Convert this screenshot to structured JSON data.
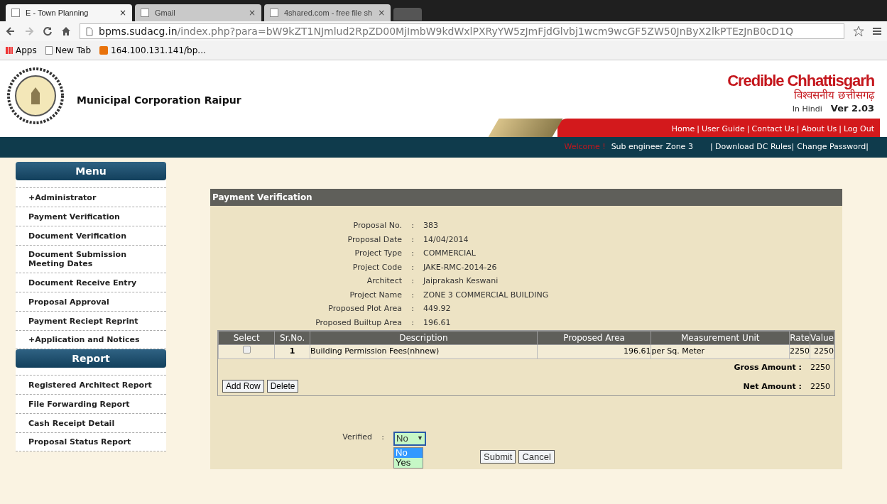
{
  "browser": {
    "tabs": [
      {
        "title": "E - Town Planning",
        "close": "×",
        "selected": true
      },
      {
        "title": "Gmail",
        "close": "×",
        "selected": false
      },
      {
        "title": "4shared.com - free file sh",
        "close": "×",
        "selected": false
      }
    ],
    "url_host": "bpms.sudacg.in",
    "url_path": "/index.php?para=bW9kZT1NJmlud2RpZD00MjImbW9kdWxlPXRyYW5zJmFjdGlvbj1wcm9wcGF5ZW50JnByX2lkPTEzJnB0cD1Q",
    "bookmarks": [
      {
        "label": "Apps",
        "kind": "apps"
      },
      {
        "label": "New Tab",
        "kind": "page"
      },
      {
        "label": "164.100.131.141/bp...",
        "kind": "site"
      }
    ]
  },
  "header": {
    "org_name": "Municipal Corporation Raipur",
    "brand": "Credible Chhattisgarh",
    "brand_hindi": "विश्वसनीय छत्तीसगढ़",
    "language_link": "In Hindi",
    "version": "Ver 2.03",
    "separator": "|",
    "nav_links": [
      "Home",
      "User Guide",
      "Contact Us",
      "About Us",
      "Log Out"
    ]
  },
  "user_bar": {
    "welcome": "Welcome !",
    "user": "Sub engineer Zone 3",
    "links": [
      "| Download DC Rules|",
      "Change Password|"
    ]
  },
  "sidebar": [
    {
      "title": "Menu",
      "items": [
        "+Administrator",
        "Payment Verification",
        "Document Verification",
        "Document Submission Meeting Dates",
        "Document Receive Entry",
        "Proposal Approval",
        "Payment Reciept Reprint",
        "+Application and Notices"
      ]
    },
    {
      "title": "Report",
      "items": [
        "Registered Architect Report",
        "File Forwarding Report",
        "Cash Receipt Detail",
        "Proposal Status Report"
      ]
    }
  ],
  "panel": {
    "title": "Payment Verification",
    "separator": ":",
    "fields": [
      {
        "label": "Proposal No.",
        "value": "383"
      },
      {
        "label": "Proposal Date",
        "value": "14/04/2014"
      },
      {
        "label": "Project Type",
        "value": "COMMERCIAL"
      },
      {
        "label": "Project Code",
        "value": "JAKE-RMC-2014-26"
      },
      {
        "label": "Architect",
        "value": "Jaiprakash Keswani"
      },
      {
        "label": "Project Name",
        "value": "ZONE 3 COMMERCIAL BUILDING"
      },
      {
        "label": "Proposed Plot Area",
        "value": "449.92"
      },
      {
        "label": "Proposed Builtup Area",
        "value": "196.61"
      }
    ],
    "table": {
      "columns": [
        "Select",
        "Sr.No.",
        "Description",
        "Proposed Area",
        "Measurement Unit",
        "Rate",
        "Value"
      ],
      "rows": [
        {
          "checked": false,
          "sr_no": "1",
          "description": "Building Permission Fees(nhnew)",
          "proposed_area": "196.61",
          "unit": "per Sq. Meter",
          "rate": "2250",
          "value": "2250"
        }
      ]
    },
    "totals": [
      {
        "label": "Gross Amount :",
        "value": "2250"
      },
      {
        "label": "Net Amount :",
        "value": "2250"
      }
    ],
    "row_buttons": [
      "Add Row",
      "Delete"
    ],
    "verified": {
      "label": "Verified",
      "value": "No",
      "arrow": "▼",
      "expanded": true,
      "options": [
        {
          "label": "No",
          "selected": true
        },
        {
          "label": "Yes",
          "selected": false
        }
      ]
    },
    "actions": [
      "Submit",
      "Cancel"
    ]
  }
}
